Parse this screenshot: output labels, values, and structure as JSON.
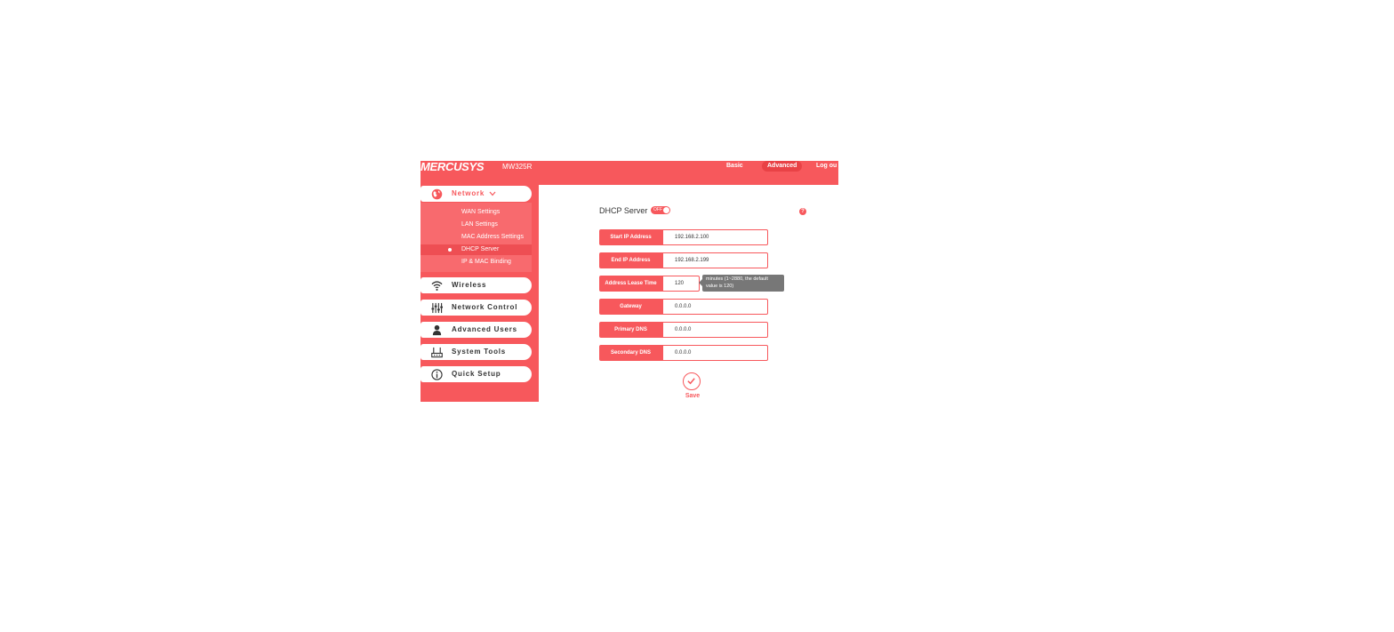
{
  "header": {
    "logo": "MERCUSYS",
    "model": "MW325R",
    "nav": {
      "basic": "Basic",
      "advanced": "Advanced",
      "logout": "Log ou"
    }
  },
  "sidebar": {
    "menus": [
      {
        "label": "Network",
        "icon": "globe-icon"
      },
      {
        "label": "Wireless",
        "icon": "wifi-icon"
      },
      {
        "label": "Network Control",
        "icon": "sliders-icon"
      },
      {
        "label": "Advanced Users",
        "icon": "user-icon"
      },
      {
        "label": "System Tools",
        "icon": "router-icon"
      },
      {
        "label": "Quick Setup",
        "icon": "info-icon"
      }
    ],
    "network_sub": [
      {
        "label": "WAN Settings"
      },
      {
        "label": "LAN Settings"
      },
      {
        "label": "MAC Address Settings"
      },
      {
        "label": "DHCP Server",
        "active": true
      },
      {
        "label": "IP & MAC Binding"
      }
    ]
  },
  "main": {
    "title": "DHCP Server",
    "toggle_text": "OFF",
    "help_icon": "?",
    "fields": [
      {
        "label": "Start IP Address",
        "value": "192.168.2.100"
      },
      {
        "label": "End IP Address",
        "value": "192.168.2.199"
      },
      {
        "label": "Address Lease Time",
        "value": "120"
      },
      {
        "label": "Gateway",
        "value": "0.0.0.0"
      },
      {
        "label": "Primary DNS",
        "value": "0.0.0.0"
      },
      {
        "label": "Secondary DNS",
        "value": "0.0.0.0"
      }
    ],
    "lease_hint_line1": "minutes (1~2880, the default",
    "lease_hint_line2": "value is 120)",
    "save_label": "Save"
  },
  "colors": {
    "accent": "#f7585c",
    "accent_dark": "#e94246",
    "tooltip": "#777777"
  }
}
